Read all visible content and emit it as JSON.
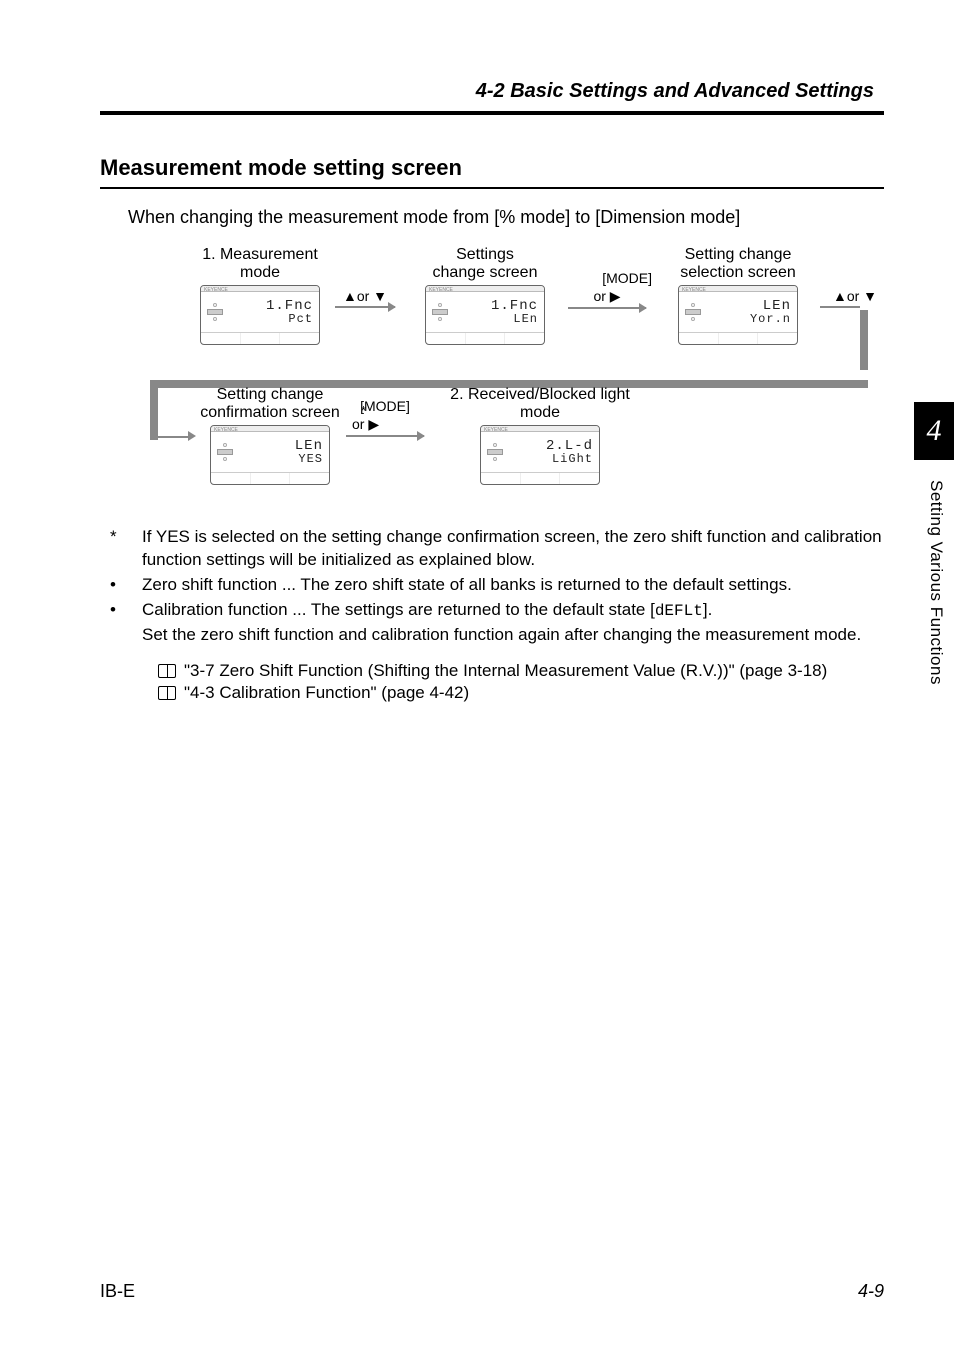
{
  "header": {
    "running": "4-2  Basic Settings and Advanced Settings"
  },
  "section": {
    "title": "Measurement mode setting screen"
  },
  "intro": "When changing the measurement mode from [% mode] to [Dimension mode]",
  "flow": {
    "n1": {
      "label1": "1. Measurement",
      "label2": "mode",
      "seg1": "1.Fnc",
      "seg2": "Pct"
    },
    "c12": {
      "label": "▲or ▼"
    },
    "n2": {
      "label1": "Settings",
      "label2": "change screen",
      "seg1": "1.Fnc",
      "seg2": "LEn"
    },
    "c23a": {
      "label": "[MODE]"
    },
    "c23b": {
      "label": "or ▶"
    },
    "n3": {
      "label1": "Setting change",
      "label2": "selection screen",
      "seg1": "LEn",
      "seg2": "Yor.n"
    },
    "c3r": {
      "label": "▲or ▼"
    },
    "n4": {
      "label1": "Setting change",
      "label2": "confirmation screen",
      "asterisk": "*",
      "seg1": "LEn",
      "seg2": "YES"
    },
    "c45a": {
      "label": "[MODE]"
    },
    "c45b": {
      "label": "or ▶"
    },
    "n5": {
      "label1": "2. Received/Blocked light",
      "label2": "mode",
      "seg1": "2.L-d",
      "seg2": "LiGht"
    }
  },
  "notes": {
    "n1": "If YES is selected on the setting change confirmation screen, the zero shift function and calibration function settings will be initialized as explained blow.",
    "n2": "Zero shift function ... The zero shift state of all banks is returned to the default settings.",
    "n3a": "Calibration function ... The settings are returned to the default state [",
    "n3code": "dEFLt",
    "n3b": "].",
    "n4": "Set the zero shift function and calibration function again after changing the measurement mode."
  },
  "refs": {
    "r1": "\"3-7 Zero Shift Function (Shifting the Internal Measurement Value (R.V.))\" (page 3-18)",
    "r2": "\"4-3 Calibration Function\" (page 4-42)"
  },
  "side": {
    "num": "4",
    "text": "Setting Various Functions"
  },
  "footer": {
    "left": "IB-E",
    "right": "4-9"
  }
}
